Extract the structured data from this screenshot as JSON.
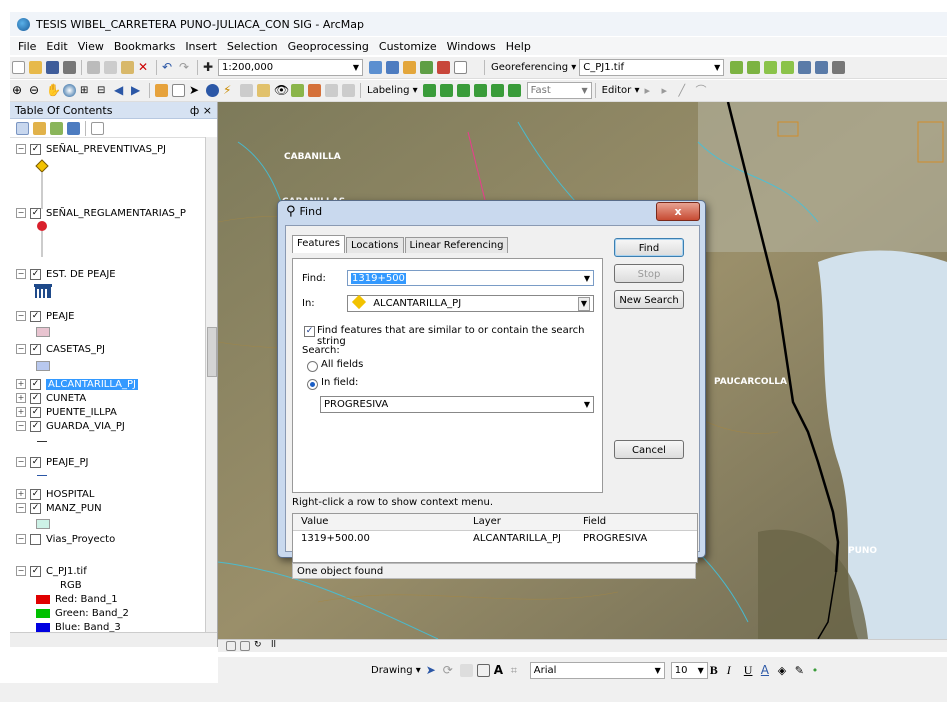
{
  "window": {
    "title": "TESIS WIBEL_CARRETERA PUNO-JULIACA_CON SIG - ArcMap"
  },
  "menu": [
    "File",
    "Edit",
    "View",
    "Bookmarks",
    "Insert",
    "Selection",
    "Geoprocessing",
    "Customize",
    "Windows",
    "Help"
  ],
  "toolbar": {
    "scale": "1:200,000",
    "georef_label": "Georeferencing",
    "georef_layer": "C_PJ1.tif",
    "labeling_label": "Labeling",
    "fast_label": "Fast",
    "editor_label": "Editor"
  },
  "toc": {
    "title": "Table Of Contents",
    "pin": "ф ×",
    "layers": [
      {
        "name": "SEÑAL_PREVENTIVAS_PJ",
        "checked": true,
        "expanded": true
      },
      {
        "name": "SEÑAL_REGLAMENTARIAS_P",
        "checked": true,
        "expanded": true
      },
      {
        "name": "EST. DE PEAJE",
        "checked": true,
        "expanded": true
      },
      {
        "name": "PEAJE",
        "checked": true,
        "expanded": true
      },
      {
        "name": "CASETAS_PJ",
        "checked": true,
        "expanded": true
      },
      {
        "name": "ALCANTARILLA_PJ",
        "checked": true,
        "expanded": false,
        "selected": true
      },
      {
        "name": "CUNETA",
        "checked": true,
        "expanded": false
      },
      {
        "name": "PUENTE_ILLPA",
        "checked": true,
        "expanded": false
      },
      {
        "name": "GUARDA_VIA_PJ",
        "checked": true,
        "expanded": true
      },
      {
        "name": "PEAJE_PJ",
        "checked": true,
        "expanded": true
      },
      {
        "name": "HOSPITAL",
        "checked": true,
        "expanded": false
      },
      {
        "name": "MANZ_PUN",
        "checked": true,
        "expanded": true
      },
      {
        "name": "Vias_Proyecto",
        "checked": false,
        "expanded": true
      },
      {
        "name": "C_PJ1.tif",
        "checked": true,
        "expanded": true
      }
    ],
    "rgb_label": "RGB",
    "bands": [
      {
        "label": "Red:  Band_1",
        "color": "#e00000"
      },
      {
        "label": "Green: Band_2",
        "color": "#00c000"
      },
      {
        "label": "Blue:  Band_3",
        "color": "#0000e0"
      }
    ]
  },
  "map": {
    "labels": [
      "CABANILLA",
      "CABANILLAS",
      "PAUCARCOLLA",
      "PUNO"
    ]
  },
  "find_dialog": {
    "title": "Find",
    "close": "x",
    "tabs": [
      "Features",
      "Locations",
      "Linear Referencing"
    ],
    "find_label": "Find:",
    "find_value": "1319+500",
    "in_label": "In:",
    "in_value": "ALCANTARILLA_PJ",
    "similar_label": "Find features that are similar to or contain the search string",
    "search_label": "Search:",
    "all_fields_label": "All fields",
    "in_field_label": "In field:",
    "in_field_value": "PROGRESIVA",
    "buttons": {
      "find": "Find",
      "stop": "Stop",
      "new_search": "New Search",
      "cancel": "Cancel"
    },
    "hint": "Right-click a row to show context menu.",
    "results": {
      "columns": [
        "Value",
        "Layer",
        "Field"
      ],
      "rows": [
        [
          "1319+500.00",
          "ALCANTARILLA_PJ",
          "PROGRESIVA"
        ]
      ]
    },
    "status": "One object found"
  },
  "drawing": {
    "label": "Drawing",
    "font": "Arial",
    "size": "10"
  }
}
